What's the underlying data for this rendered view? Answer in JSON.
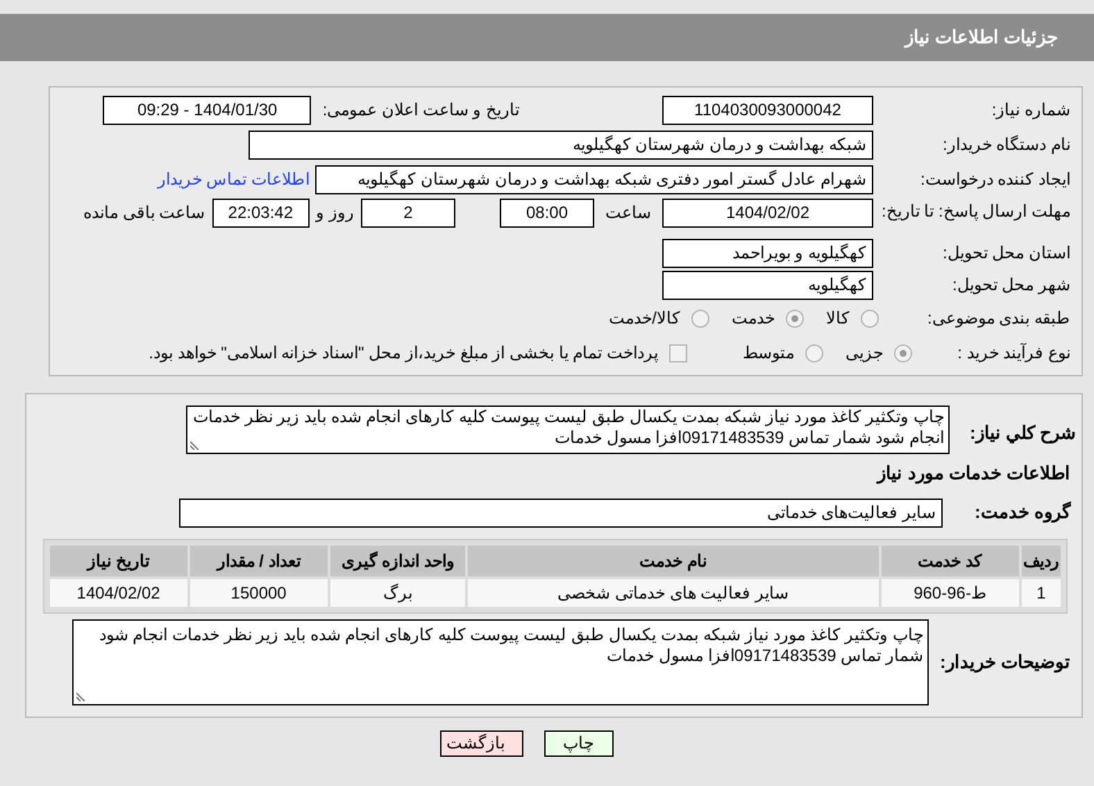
{
  "title": "جزئیات اطلاعات نیاز",
  "details": {
    "need_number": {
      "label": "شماره نیاز:",
      "value": "1104030093000042"
    },
    "announce": {
      "label": "تاریخ و ساعت اعلان عمومی:",
      "value": "1404/01/30 - 09:29"
    },
    "buyer_org": {
      "label": "نام دستگاه خریدار:",
      "value": "شبکه بهداشت و درمان شهرستان کهگیلویه"
    },
    "requester": {
      "label": "ایجاد کننده درخواست:",
      "value": "شهرام عادل گستر امور دفتری شبکه بهداشت و درمان شهرستان کهگیلویه",
      "link": "اطلاعات تماس خریدار"
    },
    "deadline": {
      "label": "مهلت ارسال پاسخ: تا تاریخ:",
      "date": "1404/02/02",
      "time_label": "ساعت",
      "time": "08:00",
      "days": "2",
      "days_label": "روز و",
      "remaining": "22:03:42",
      "remaining_label": "ساعت باقی مانده"
    },
    "province": {
      "label": "استان محل تحویل:",
      "value": "کهگیلویه و بویراحمد"
    },
    "city": {
      "label": "شهر محل تحویل:",
      "value": "کهگیلویه"
    },
    "category": {
      "label": "طبقه بندی موضوعی:",
      "options": [
        {
          "label": "کالا",
          "selected": false
        },
        {
          "label": "خدمت",
          "selected": true
        },
        {
          "label": "کالا/خدمت",
          "selected": false
        }
      ]
    },
    "process": {
      "label": "نوع فرآیند خرید :",
      "options": [
        {
          "label": "جزیی",
          "selected": true
        },
        {
          "label": "متوسط",
          "selected": false
        }
      ],
      "payment": {
        "label": "پرداخت تمام یا بخشی از مبلغ خرید،از محل \"اسناد خزانه اسلامی\" خواهد بود.",
        "checked": false
      }
    }
  },
  "services": {
    "summary": {
      "label": "شرح کلي نياز:",
      "value": "چاپ وتکثیر کاغذ مورد نیاز شبکه بمدت یکسال طبق لیست پیوست  کلیه کارهای انجام شده باید زیر نظر خدمات انجام شود شمار تماس 09171483539افزا مسول خدمات"
    },
    "heading": "اطلاعات خدمات مورد نیاز",
    "group": {
      "label": "گروه خدمت:",
      "value": "سایر فعالیت‌های خدماتی"
    },
    "table": {
      "columns": [
        "ردیف",
        "کد خدمت",
        "نام خدمت",
        "واحد اندازه گیری",
        "تعداد / مقدار",
        "تاریخ نیاز"
      ],
      "rows": [
        [
          "1",
          "ط-96-960",
          "سایر فعالیت های خدماتی شخصی",
          "برگ",
          "150000",
          "1404/02/02"
        ]
      ]
    },
    "buyer_notes": {
      "label": "توضیحات خریدار:",
      "value": "چاپ وتکثیر کاغذ مورد نیاز شبکه بمدت یکسال طبق لیست پیوست  کلیه کارهای انجام شده باید زیر نظر خدمات انجام شود شمار تماس 09171483539افزا مسول خدمات"
    }
  },
  "buttons": [
    {
      "label": "چاپ",
      "kind": "print"
    },
    {
      "label": "بازگشت",
      "kind": "back"
    }
  ]
}
